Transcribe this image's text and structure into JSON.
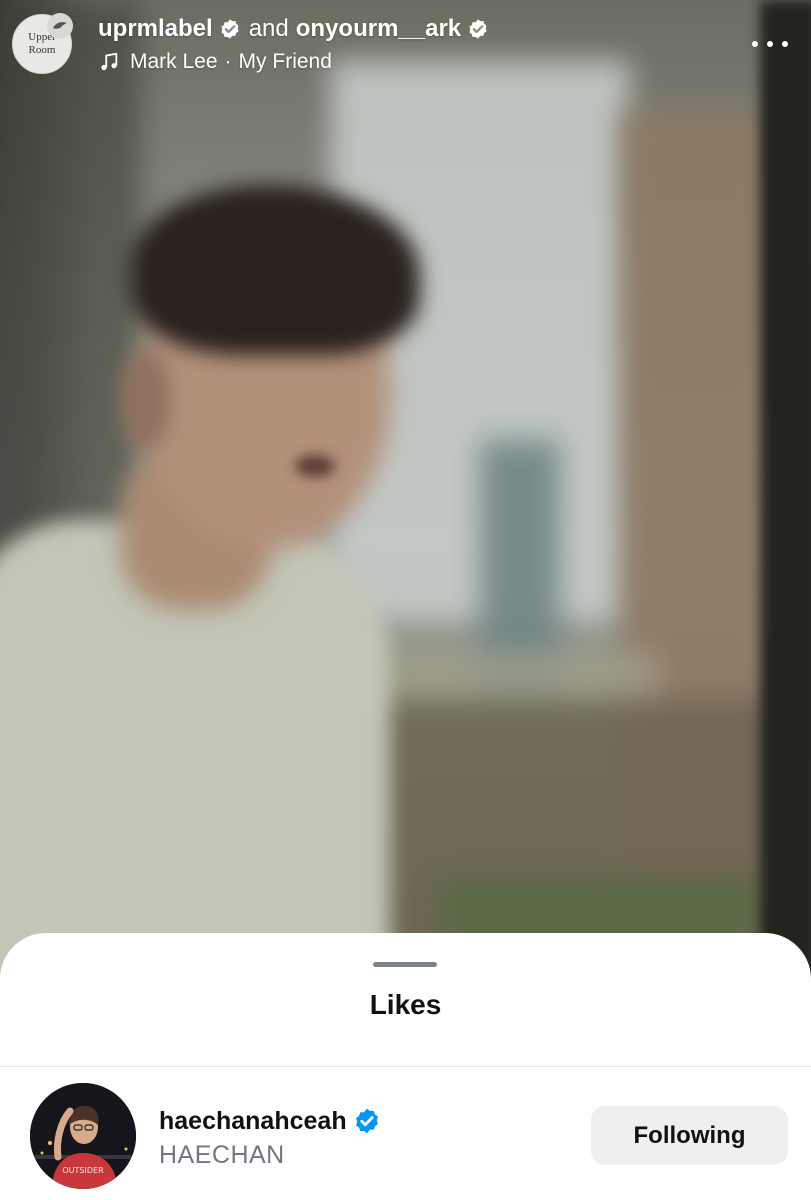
{
  "header": {
    "avatar": {
      "line1": "Upper",
      "line2": "Room"
    },
    "author1": "uprmlabel",
    "connector": "and",
    "author2": "onyourm__ark",
    "music": {
      "artist": "Mark Lee",
      "separator": "·",
      "song": "My Friend"
    },
    "more_icon": "more-horizontal-icon"
  },
  "likes_sheet": {
    "title": "Likes",
    "users": [
      {
        "username": "haechanahceah",
        "full_name": "HAECHAN",
        "verified": true,
        "button_label": "Following"
      }
    ]
  },
  "colors": {
    "verified_blue": "#0095f6",
    "sheet_bg": "#ffffff",
    "button_bg": "#efeff1"
  }
}
